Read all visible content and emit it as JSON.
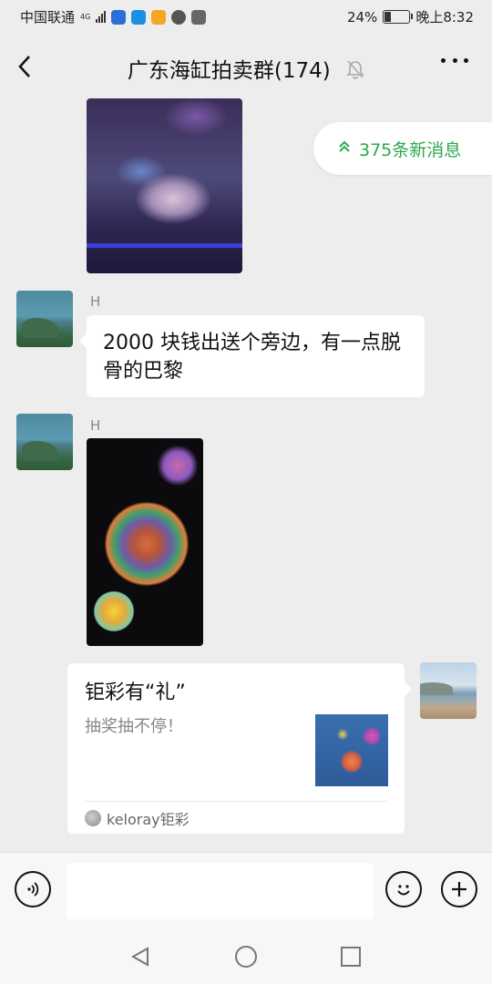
{
  "status_bar": {
    "carrier": "中国联通",
    "network": "4G",
    "battery": "24%",
    "time": "晚上8:32",
    "battery_level": 0.24
  },
  "header": {
    "title": "广东海缸拍卖群(174)",
    "back_icon": "back-arrow-icon",
    "mute_icon": "bell-muted-icon",
    "more_icon": "more-dots-icon"
  },
  "new_messages": {
    "label": "375条新消息",
    "icon": "double-chevron-up-icon",
    "color": "#2aa84f"
  },
  "messages": [
    {
      "type": "image",
      "sender": "",
      "side": "left",
      "description_icon": "coral-photo"
    },
    {
      "type": "text",
      "sender": "H",
      "side": "left",
      "text": "2000 块钱出送个旁边，有一点脱骨的巴黎"
    },
    {
      "type": "image",
      "sender": "H",
      "side": "left",
      "description_icon": "coral-photo"
    },
    {
      "type": "card",
      "side": "right",
      "title": "钜彩有“礼”",
      "desc": "抽奖抽不停！",
      "source": "keloray钜彩"
    }
  ],
  "input_bar": {
    "voice_icon": "voice-icon",
    "emoji_icon": "emoji-icon",
    "plus_icon": "plus-icon",
    "placeholder": ""
  },
  "nav_bar": {
    "back_icon": "nav-back-icon",
    "home_icon": "nav-home-icon",
    "recent_icon": "nav-recent-icon"
  }
}
